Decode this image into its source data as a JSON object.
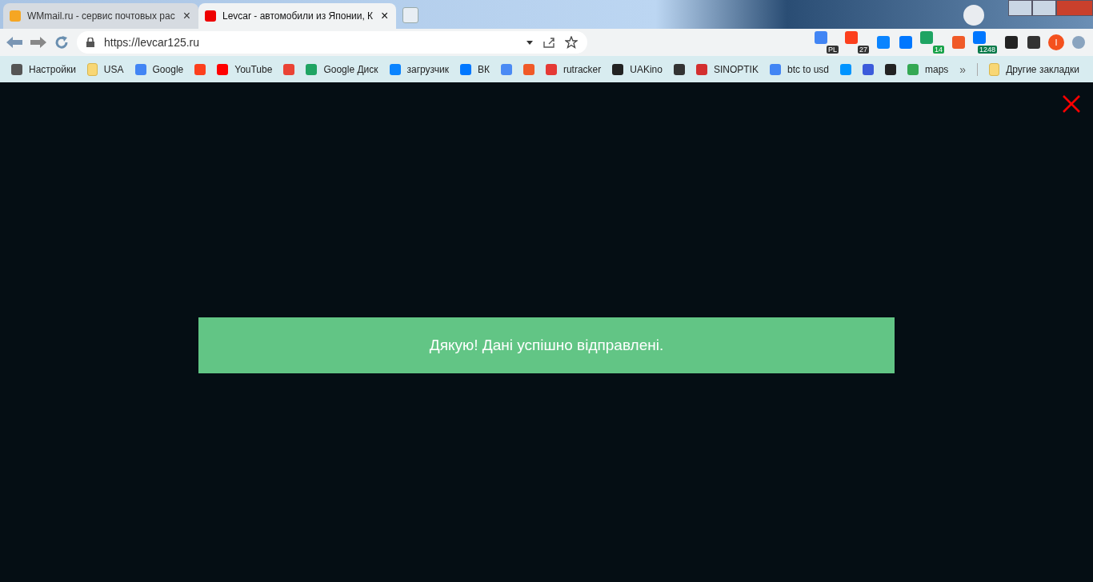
{
  "tabs": [
    {
      "title": "WMmail.ru - сервис почтовых рас",
      "close": "×",
      "selected": false
    },
    {
      "title": "Levcar - автомобили из Японии, К",
      "close": "×",
      "selected": true
    }
  ],
  "address_bar": {
    "url": "https://levcar125.ru"
  },
  "extensions": [
    {
      "kind": "badge",
      "badge": "PL"
    },
    {
      "kind": "badge",
      "badge": "27"
    },
    {
      "kind": "plain"
    },
    {
      "kind": "plain"
    },
    {
      "kind": "badge",
      "badge": "14"
    },
    {
      "kind": "plain"
    },
    {
      "kind": "badge",
      "badge": "1248"
    },
    {
      "kind": "plain"
    },
    {
      "kind": "plain"
    }
  ],
  "profile": {
    "initial": "I"
  },
  "bookmarks": [
    {
      "kind": "link",
      "label": "Настройки"
    },
    {
      "kind": "folder",
      "label": "USA"
    },
    {
      "kind": "link",
      "label": "Google"
    },
    {
      "kind": "icon"
    },
    {
      "kind": "link",
      "label": "YouTube"
    },
    {
      "kind": "icon"
    },
    {
      "kind": "link",
      "label": "Google Диск"
    },
    {
      "kind": "link",
      "label": "загрузчик"
    },
    {
      "kind": "link",
      "label": "ВК"
    },
    {
      "kind": "icon"
    },
    {
      "kind": "icon"
    },
    {
      "kind": "link",
      "label": "rutracker"
    },
    {
      "kind": "link",
      "label": "UAKino"
    },
    {
      "kind": "icon"
    },
    {
      "kind": "link",
      "label": "SINOPTIK"
    },
    {
      "kind": "link",
      "label": "btc to usd"
    },
    {
      "kind": "icon"
    },
    {
      "kind": "icon"
    },
    {
      "kind": "icon"
    },
    {
      "kind": "link",
      "label": "maps"
    }
  ],
  "bookmarks_overflow": "»",
  "other_bookmarks": {
    "label": "Другие закладки"
  },
  "notification": {
    "message": "Дякую! Дані успішно відправлені."
  }
}
